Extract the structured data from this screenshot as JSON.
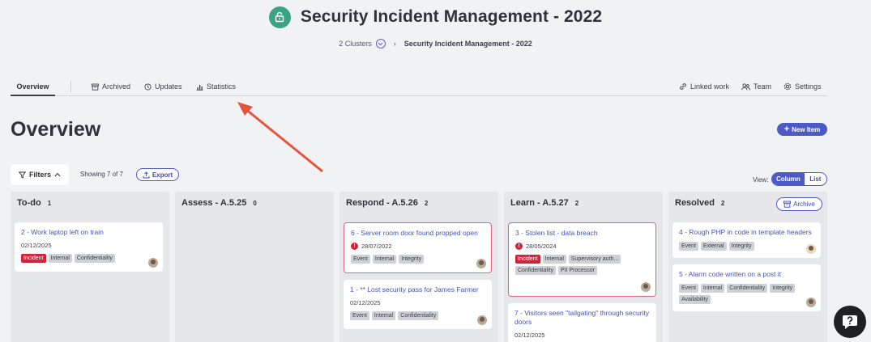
{
  "header": {
    "title": "Security Incident Management - 2022",
    "icon": "unlock-icon",
    "accent": "#3aa383",
    "breadcrumb": {
      "parent": "2 Clusters",
      "current": "Security Incident Management - 2022"
    }
  },
  "tabs": {
    "overview": "Overview",
    "archived": "Archived",
    "updates": "Updates",
    "statistics": "Statistics",
    "linked_work": "Linked work",
    "team": "Team",
    "settings": "Settings"
  },
  "main": {
    "heading": "Overview",
    "new_item": "New Item",
    "filters": "Filters",
    "showing": "Showing 7 of 7",
    "export": "Export",
    "view_label": "View:",
    "view_column": "Column",
    "view_list": "List",
    "brand_color": "#4c59c6"
  },
  "columns": [
    {
      "title": "To-do",
      "count": "1",
      "cards": [
        {
          "title": "2 - Work laptop left on train",
          "date": "02/12/2025",
          "tags": [
            "Incident",
            "Internal",
            "Confidentiality"
          ]
        }
      ]
    },
    {
      "title": "Assess - A.5.25",
      "count": "0",
      "cards": []
    },
    {
      "title": "Respond - A.5.26",
      "count": "2",
      "cards": [
        {
          "title": "6 - Server room door found propped open",
          "date": "28/07/2022",
          "tags": [
            "Event",
            "Internal",
            "Integrity"
          ]
        },
        {
          "title": "1 - ** Lost security pass for James Farmer",
          "date": "02/12/2025",
          "tags": [
            "Event",
            "Internal",
            "Confidentiality"
          ]
        }
      ]
    },
    {
      "title": "Learn - A.5.27",
      "count": "2",
      "cards": [
        {
          "title": "3 - Stolen list - data breach",
          "date": "28/05/2024",
          "tags": [
            "Incident",
            "Internal",
            "Supervisory auth...",
            "Confidentiality",
            "PII Processor"
          ]
        },
        {
          "title": "7 - Visitors seen \"tailgating\" through security doors",
          "date": "02/12/2025",
          "tags": []
        }
      ]
    },
    {
      "title": "Resolved",
      "count": "2",
      "archive": "Archive",
      "cards": [
        {
          "title": "4 - Rough PHP in code in template headers",
          "tags": [
            "Event",
            "External",
            "Integrity"
          ]
        },
        {
          "title": "5 - Alarm code written on a post it",
          "tags": [
            "Event",
            "Internal",
            "Confidentiality",
            "Integrity",
            "Availability"
          ]
        }
      ]
    }
  ]
}
